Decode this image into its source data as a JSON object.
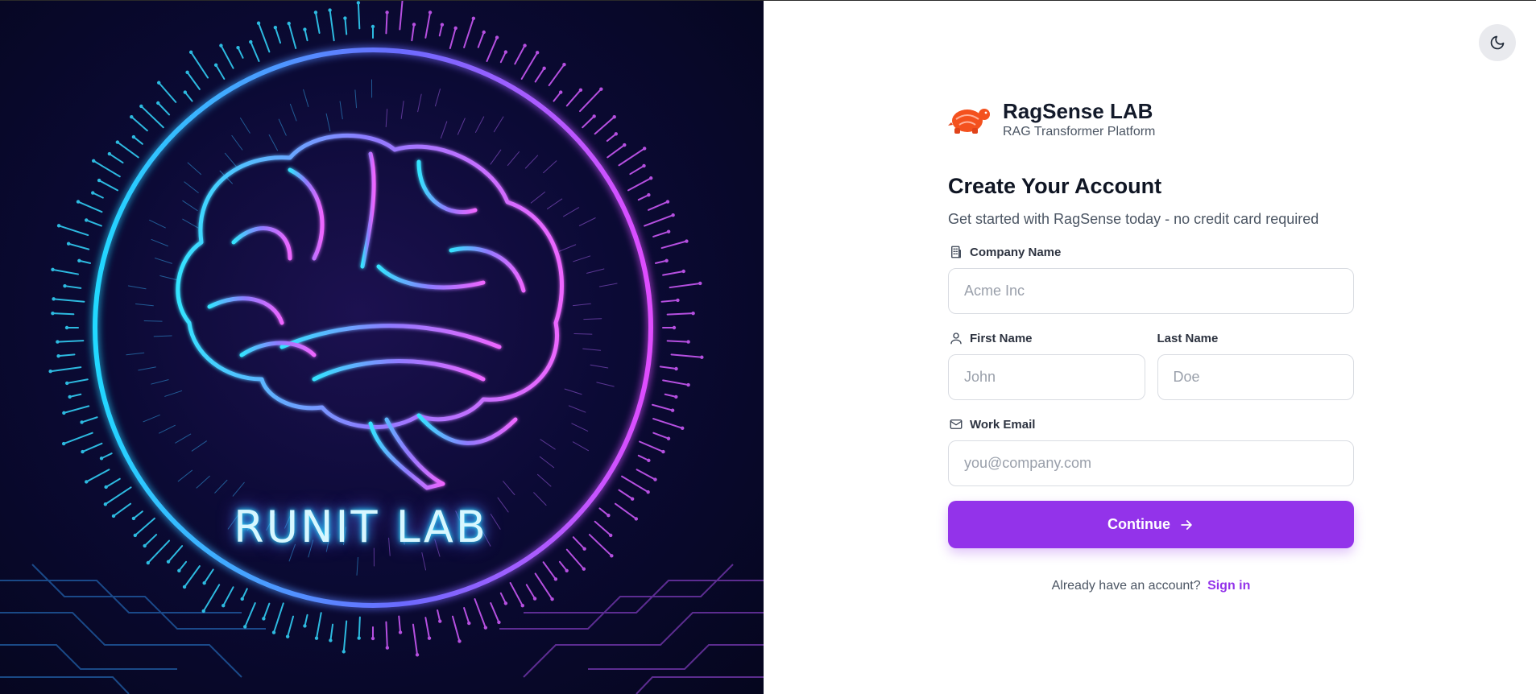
{
  "hero": {
    "title": "RUNIT LAB",
    "image_description_icon": "neon-brain-icon",
    "colors": {
      "cyan": "#2fe0ff",
      "magenta": "#e04dff",
      "background": "#0b0a35"
    }
  },
  "theme_toggle": {
    "icon": "moon-icon"
  },
  "brand": {
    "name": "RagSense LAB",
    "tagline": "RAG Transformer Platform",
    "logo_icon": "turtle-logo-icon",
    "logo_color": "#f4511e"
  },
  "form": {
    "heading": "Create Your Account",
    "subheading": "Get started with RagSense today - no credit card required",
    "company": {
      "label": "Company Name",
      "placeholder": "Acme Inc",
      "value": "",
      "icon": "building-icon"
    },
    "first_name": {
      "label": "First Name",
      "placeholder": "John",
      "value": "",
      "icon": "user-icon"
    },
    "last_name": {
      "label": "Last Name",
      "placeholder": "Doe",
      "value": ""
    },
    "email": {
      "label": "Work Email",
      "placeholder": "you@company.com",
      "value": "",
      "icon": "mail-icon"
    },
    "submit_label": "Continue",
    "submit_icon": "arrow-right-icon",
    "accent_color": "#9333ea"
  },
  "signin": {
    "prompt": "Already have an account?",
    "link_label": "Sign in"
  }
}
